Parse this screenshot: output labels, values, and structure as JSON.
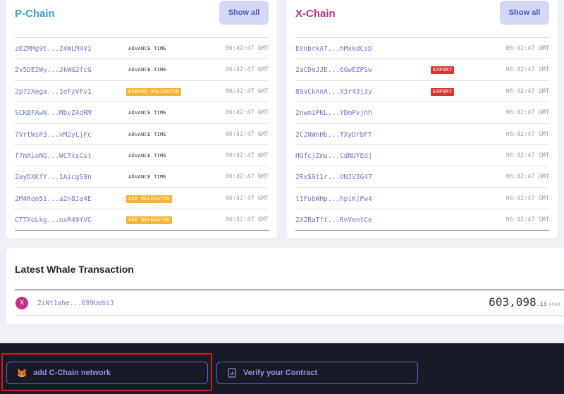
{
  "pchain": {
    "title": "P-Chain",
    "show_all": "Show all",
    "rows": [
      {
        "id": "zEZMMg9t...Z4WLM4V1",
        "type": "ADVANCE TIME",
        "time": "06:42:47 GMT"
      },
      {
        "id": "2v5DE2Wy...JkWG2fcG",
        "type": "ADVANCE TIME",
        "time": "06:42:47 GMT"
      },
      {
        "id": "2p72Xega...1eFzVFv1",
        "type": "REWARD VALIDATOR",
        "time": "06:42:47 GMT"
      },
      {
        "id": "SCKBFAwN...MbvZ4dRM",
        "type": "ADVANCE TIME",
        "time": "06:42:47 GMT"
      },
      {
        "id": "7VrtWsP3...vM2yLjFc",
        "type": "ADVANCE TIME",
        "time": "06:42:47 GMT"
      },
      {
        "id": "f7mXioNQ...WC7xsCst",
        "type": "ADVANCE TIME",
        "time": "06:42:47 GMT"
      },
      {
        "id": "2ayDXKfY...1AicgS9n",
        "type": "ADVANCE TIME",
        "time": "06:42:47 GMT"
      },
      {
        "id": "2M4Rqo51...a2n8Ja4E",
        "type": "ADD DELEGATOR",
        "time": "06:42:47 GMT"
      },
      {
        "id": "CTTXoLkg...oxR49YVC",
        "type": "ADD DELEGATOR",
        "time": "06:42:47 GMT"
      }
    ]
  },
  "xchain": {
    "title": "X-Chain",
    "show_all": "Show all",
    "rows": [
      {
        "id": "EVnbrkAT...hMxkdCsD",
        "type": "",
        "time": "06:42:47 GMT"
      },
      {
        "id": "2aCDeJJE...6GwEZPSw",
        "type": "EXPORT",
        "time": "06:42:47 GMT"
      },
      {
        "id": "89vCkAnA...X3r43j3y",
        "type": "EXPORT",
        "time": "06:42:47 GMT"
      },
      {
        "id": "2nwmiPKL...YDmPvjhh",
        "type": "",
        "time": "06:42:47 GMT"
      },
      {
        "id": "2C2NWnHb...TXyDrbFT",
        "type": "",
        "time": "06:42:47 GMT"
      },
      {
        "id": "HQfcjZmu...CdNUYEdj",
        "type": "",
        "time": "06:42:47 GMT"
      },
      {
        "id": "2RxS9t1r...UNJV3G47",
        "type": "",
        "time": "06:42:47 GMT"
      },
      {
        "id": "t1FobWHp...hpiKjPw4",
        "type": "",
        "time": "06:42:47 GMT"
      },
      {
        "id": "2X2BaTft...RnVentCe",
        "type": "",
        "time": "06:42:47 GMT"
      }
    ]
  },
  "whale": {
    "title": "Latest Whale Transaction",
    "chain_letter": "X",
    "tx_id": "2iNt1ahe...699UebiJ",
    "amount_int": "603,098",
    "amount_dec": ".13",
    "unit": "AVAX"
  },
  "footer": {
    "cchain_label": "add C-Chain network",
    "verify_label": "Verify your Contract",
    "cchain_icon": "metamask-fox-icon",
    "verify_icon": "contract-document-icon"
  },
  "colors": {
    "pchain_title": "#3a9fd4",
    "xchain_title": "#c2318a",
    "tx_link": "#6f78cf",
    "badge_orange": "#f6b434",
    "badge_red": "#d33b32",
    "footer_bg": "#181b26",
    "highlight": "#d6191d"
  }
}
